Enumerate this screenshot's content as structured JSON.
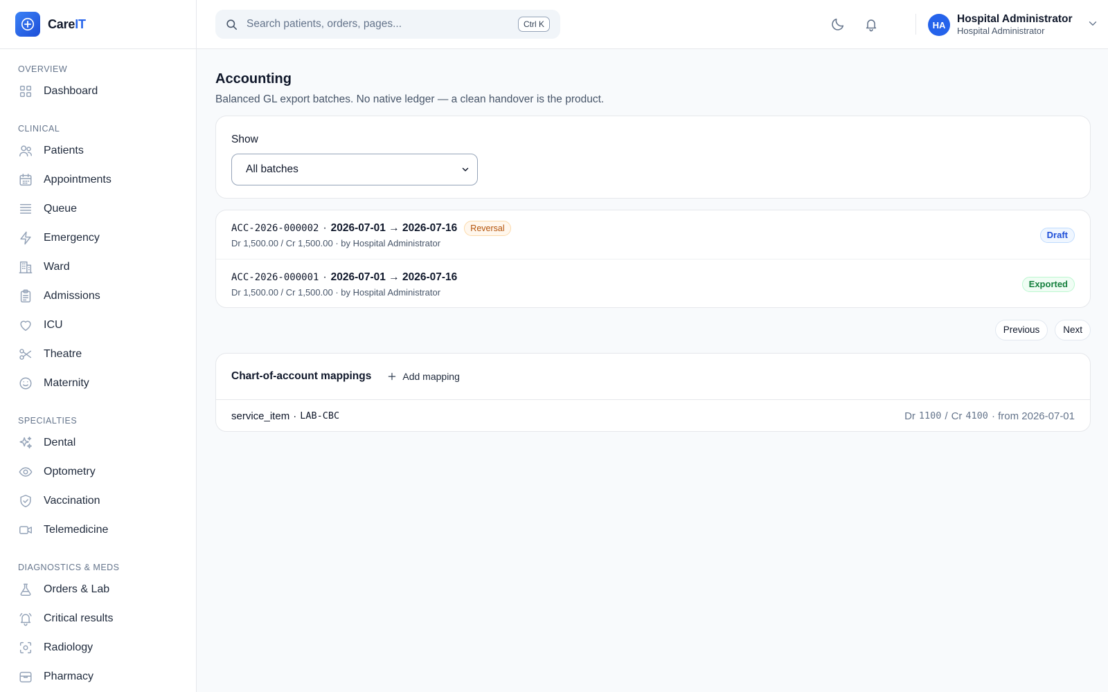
{
  "app": {
    "name_main": "Care",
    "name_accent": "IT"
  },
  "search": {
    "placeholder": "Search patients, orders, pages...",
    "shortcut": "Ctrl K"
  },
  "user": {
    "initials": "HA",
    "name": "Hospital Administrator",
    "role": "Hospital Administrator"
  },
  "sidebar": {
    "sections": [
      {
        "title": "OVERVIEW",
        "items": [
          {
            "label": "Dashboard",
            "icon": "grid-icon"
          }
        ]
      },
      {
        "title": "CLINICAL",
        "items": [
          {
            "label": "Patients",
            "icon": "users-icon"
          },
          {
            "label": "Appointments",
            "icon": "calendar-icon"
          },
          {
            "label": "Queue",
            "icon": "list-icon"
          },
          {
            "label": "Emergency",
            "icon": "bolt-icon"
          },
          {
            "label": "Ward",
            "icon": "building-icon"
          },
          {
            "label": "Admissions",
            "icon": "clipboard-icon"
          },
          {
            "label": "ICU",
            "icon": "heart-icon"
          },
          {
            "label": "Theatre",
            "icon": "scissors-icon"
          },
          {
            "label": "Maternity",
            "icon": "smile-icon"
          }
        ]
      },
      {
        "title": "SPECIALTIES",
        "items": [
          {
            "label": "Dental",
            "icon": "sparkles-icon"
          },
          {
            "label": "Optometry",
            "icon": "eye-icon"
          },
          {
            "label": "Vaccination",
            "icon": "shield-check-icon"
          },
          {
            "label": "Telemedicine",
            "icon": "video-icon"
          }
        ]
      },
      {
        "title": "DIAGNOSTICS & MEDS",
        "items": [
          {
            "label": "Orders & Lab",
            "icon": "flask-icon"
          },
          {
            "label": "Critical results",
            "icon": "bell-alert-icon"
          },
          {
            "label": "Radiology",
            "icon": "scan-icon"
          },
          {
            "label": "Pharmacy",
            "icon": "box-icon"
          }
        ]
      }
    ]
  },
  "page": {
    "title": "Accounting",
    "subtitle": "Balanced GL export batches. No native ledger — a clean handover is the product."
  },
  "filter": {
    "label": "Show",
    "selected": "All batches"
  },
  "batches": [
    {
      "code": "ACC-2026-000002",
      "sep": "·",
      "dates": "2026-07-01 → 2026-07-16",
      "tag": "Reversal",
      "meta": "Dr 1,500.00 / Cr 1,500.00 · by Hospital Administrator",
      "status": "Draft",
      "status_color": "#1d4ed8"
    },
    {
      "code": "ACC-2026-000001",
      "sep": "·",
      "dates": "2026-07-01 → 2026-07-16",
      "tag": "",
      "meta": "Dr 1,500.00 / Cr 1,500.00 · by Hospital Administrator",
      "status": "Exported",
      "status_color": "#15803d"
    }
  ],
  "pager": {
    "previous": "Previous",
    "next": "Next"
  },
  "mappings": {
    "title": "Chart-of-account mappings",
    "add_label": "Add mapping",
    "rows": [
      {
        "source": "service_item",
        "sep": "·",
        "code": "LAB-CBC",
        "dr_label": "Dr",
        "dr": "1100",
        "slash": "/",
        "cr_label": "Cr",
        "cr": "4100",
        "from": "· from 2026-07-01"
      }
    ]
  },
  "colors": {
    "accent": "#2563eb",
    "reversal": "#b45309",
    "draft": "#1d4ed8",
    "exported": "#15803d"
  }
}
